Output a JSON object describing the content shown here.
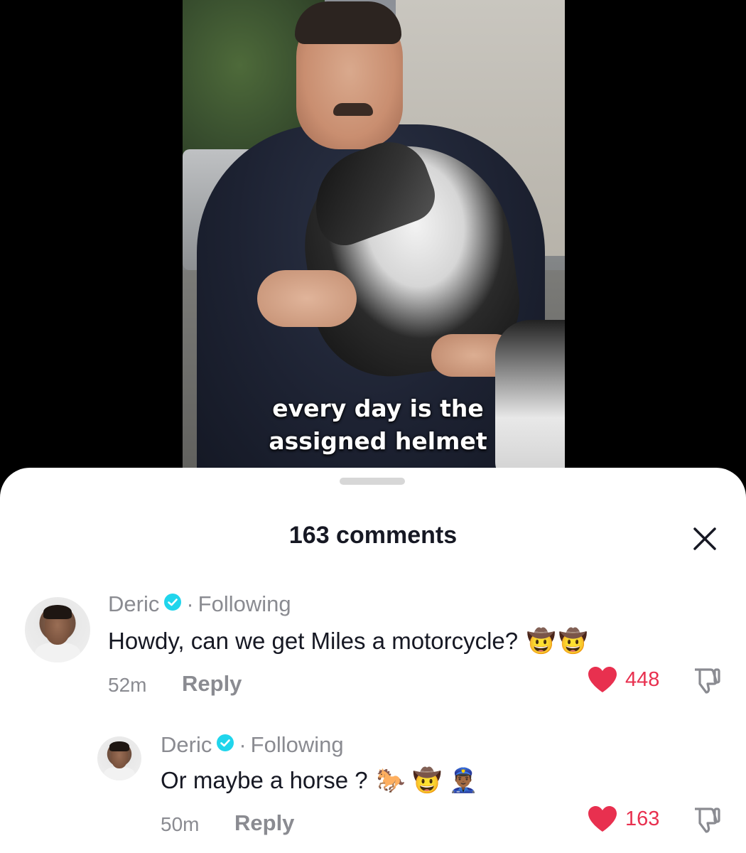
{
  "video": {
    "caption_line1": "every day is the",
    "caption_line2": "assigned helmet"
  },
  "comments_sheet": {
    "title": "163 comments",
    "close_icon": "close-icon"
  },
  "comments": [
    {
      "username": "Deric",
      "verified": true,
      "separator": "·",
      "relationship": "Following",
      "text": "Howdy, can we get Miles a motorcycle?",
      "emojis": [
        "🤠",
        "🤠"
      ],
      "time": "52m",
      "reply_label": "Reply",
      "like_count": "448"
    },
    {
      "username": "Deric",
      "verified": true,
      "separator": "·",
      "relationship": "Following",
      "text": "Or maybe a horse ?",
      "emojis": [
        "🐎",
        "🤠",
        "👮🏾‍♂️"
      ],
      "time": "50m",
      "reply_label": "Reply",
      "like_count": "163"
    }
  ],
  "colors": {
    "like": "#e8304f",
    "verified": "#20d5ec",
    "muted_text": "#8a8b91",
    "primary_text": "#161823"
  }
}
